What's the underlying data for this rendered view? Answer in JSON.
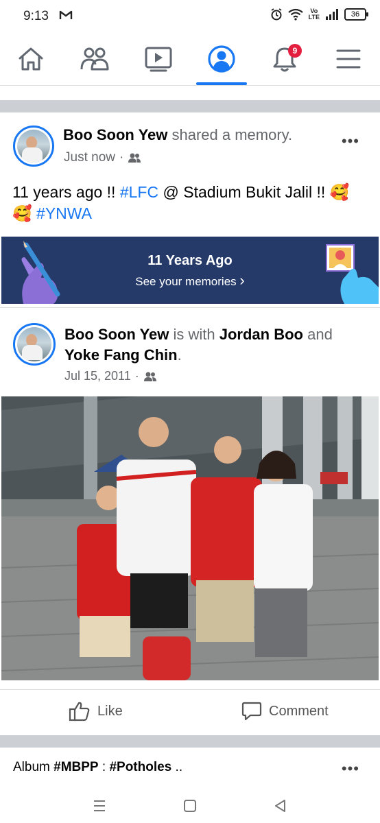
{
  "status_bar": {
    "time": "9:13",
    "volte_top": "Vo",
    "volte_bottom": "LTE",
    "battery": "36"
  },
  "nav": {
    "items": [
      {
        "name": "home-icon",
        "active": false
      },
      {
        "name": "friends-icon",
        "active": false
      },
      {
        "name": "watch-icon",
        "active": false
      },
      {
        "name": "profile-icon",
        "active": true
      },
      {
        "name": "notifications-icon",
        "active": false
      },
      {
        "name": "menu-icon",
        "active": false
      }
    ],
    "notification_count": "9",
    "accent_color": "#1877f2",
    "badge_color": "#e41e3f"
  },
  "post": {
    "author": "Boo Soon Yew",
    "action": " shared a memory.",
    "time": "Just now",
    "separator": "·",
    "text_before": "11 years ago !! ",
    "hashtag_lfc": "#LFC",
    "text_middle": " @ Stadium Bukit Jalil !! ",
    "emoji": "🥰",
    "emoji2": "🥰",
    "hashtag_ynwa": "#YNWA"
  },
  "memories": {
    "title": "11 Years Ago",
    "link": "See your memories",
    "chevron": "›",
    "background": "#263a69"
  },
  "shared_post": {
    "author": "Boo Soon Yew",
    "with_text": " is with ",
    "tag1": "Jordan Boo",
    "and_text": " and ",
    "tag2": "Yoke Fang Chin",
    "period": ".",
    "date": "Jul 15, 2011",
    "separator": "·"
  },
  "actions": {
    "like": "Like",
    "comment": "Comment"
  },
  "next_post": {
    "prefix": "Album ",
    "tag1": "#MBPP",
    "middle": " : ",
    "tag2": "#Potholes",
    "suffix": " .."
  }
}
